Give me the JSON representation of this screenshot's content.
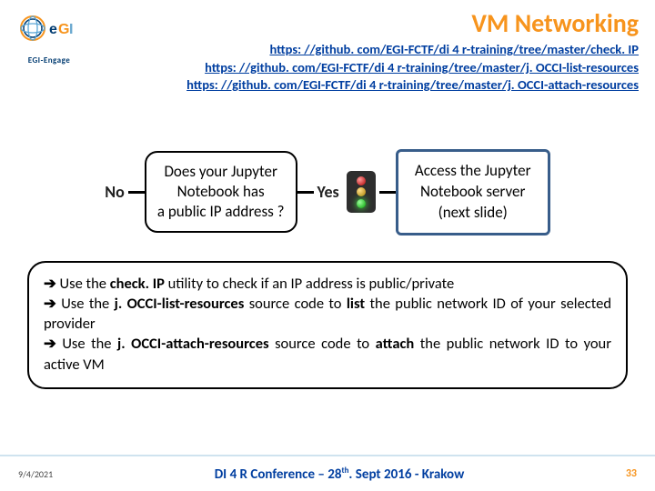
{
  "header": {
    "logo_text": "EGI-Engage",
    "title": "VM Networking",
    "links": [
      "https: //github. com/EGI-FCTF/di 4 r-training/tree/master/check. IP",
      "https: //github. com/EGI-FCTF/di 4 r-training/tree/master/j. OCCI-list-resources",
      "https: //github. com/EGI-FCTF/di 4 r-training/tree/master/j. OCCI-attach-resources"
    ]
  },
  "diagram": {
    "no_label": "No",
    "decision_l1": "Does your Jupyter",
    "decision_l2": "Notebook has",
    "decision_l3": "a public IP address ?",
    "yes_label": "Yes",
    "outcome_l1": "Access the Jupyter",
    "outcome_l2": "Notebook server",
    "outcome_l3": "(next slide)"
  },
  "bullets": {
    "arrow": "➔",
    "b1_pre": "  Use the ",
    "b1_bold": "check. IP",
    "b1_post": " utility to check if an IP address is public/private",
    "b2_pre": "  Use the ",
    "b2_bold": "j. OCCI-list-resources",
    "b2_mid": " source code to ",
    "b2_bold2": "list",
    "b2_post": " the public network ID of your selected provider",
    "b3_pre": " Use the ",
    "b3_bold": "j. OCCI-attach-resources",
    "b3_mid": " source code to ",
    "b3_bold2": "attach",
    "b3_post": " the public network ID to your active VM"
  },
  "footer": {
    "date": "9/4/2021",
    "center_pre": "DI 4 R Conference – 28",
    "center_sup": "th",
    "center_post": ". Sept 2016 - Krakow",
    "page": "33"
  }
}
